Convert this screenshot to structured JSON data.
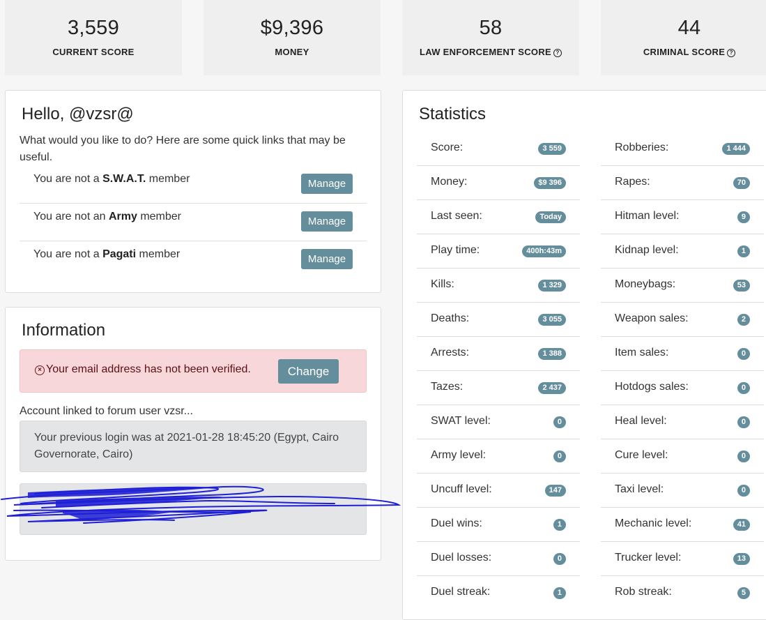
{
  "summary": [
    {
      "value": "3,559",
      "label": "CURRENT SCORE",
      "help": false
    },
    {
      "value": "$9,396",
      "label": "MONEY",
      "help": false
    },
    {
      "value": "58",
      "label": "LAW ENFORCEMENT SCORE",
      "help": true
    },
    {
      "value": "44",
      "label": "CRIMINAL SCORE",
      "help": true
    }
  ],
  "hello": {
    "title": "Hello, @vzsr@",
    "intro": "What would you like to do? Here are some quick links that may be useful.",
    "memberships": [
      {
        "prefix": "You are not a",
        "group": "S.W.A.T.",
        "suffix": "member",
        "button": "Manage"
      },
      {
        "prefix": "You are not an",
        "group": "Army",
        "suffix": "member",
        "button": "Manage"
      },
      {
        "prefix": "You are not a",
        "group": "Pagati",
        "suffix": "member",
        "button": "Manage"
      }
    ]
  },
  "information": {
    "title": "Information",
    "alert_text": "Your email address has not been verified.",
    "alert_button": "Change",
    "linked": "Account linked to forum user vzsr...",
    "previous_login": "Your previous login was at 2021-01-28 18:45:20 (Egypt, Cairo Governorate, Cairo)"
  },
  "statistics": {
    "title": "Statistics",
    "left": [
      {
        "label": "Score:",
        "value": "3 559"
      },
      {
        "label": "Money:",
        "value": "$9 396"
      },
      {
        "label": "Last seen:",
        "value": "Today"
      },
      {
        "label": "Play time:",
        "value": "400h:43m"
      },
      {
        "label": "Kills:",
        "value": "1 329"
      },
      {
        "label": "Deaths:",
        "value": "3 055"
      },
      {
        "label": "Arrests:",
        "value": "1 388"
      },
      {
        "label": "Tazes:",
        "value": "2 437"
      },
      {
        "label": "SWAT level:",
        "value": "0"
      },
      {
        "label": "Army level:",
        "value": "0"
      },
      {
        "label": "Uncuff level:",
        "value": "147"
      },
      {
        "label": "Duel wins:",
        "value": "1"
      },
      {
        "label": "Duel losses:",
        "value": "0"
      },
      {
        "label": "Duel streak:",
        "value": "1"
      }
    ],
    "right": [
      {
        "label": "Robberies:",
        "value": "1 444"
      },
      {
        "label": "Rapes:",
        "value": "70"
      },
      {
        "label": "Hitman level:",
        "value": "9"
      },
      {
        "label": "Kidnap level:",
        "value": "1"
      },
      {
        "label": "Moneybags:",
        "value": "53"
      },
      {
        "label": "Weapon sales:",
        "value": "2"
      },
      {
        "label": "Item sales:",
        "value": "0"
      },
      {
        "label": "Hotdogs sales:",
        "value": "0"
      },
      {
        "label": "Heal level:",
        "value": "0"
      },
      {
        "label": "Cure level:",
        "value": "0"
      },
      {
        "label": "Taxi level:",
        "value": "0"
      },
      {
        "label": "Mechanic level:",
        "value": "41"
      },
      {
        "label": "Trucker level:",
        "value": "13"
      },
      {
        "label": "Rob streak:",
        "value": "5"
      }
    ]
  },
  "colors": {
    "accent": "#658e9c",
    "alert_bg": "#f8d7da",
    "scribble": "#1f1fd6"
  }
}
